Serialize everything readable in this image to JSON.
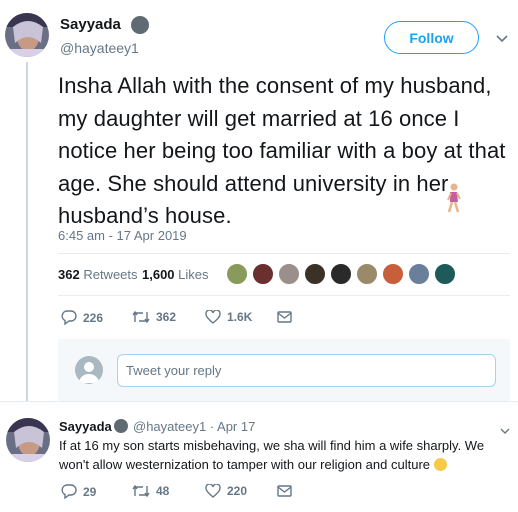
{
  "tweet": {
    "display_name": "Sayyada",
    "handle": "@hayateey1",
    "follow_label": "Follow",
    "text": "Insha Allah with the consent of my husband, my daughter will get married at 16 once I notice her being too familiar with a boy at that age. She should attend university in her husband’s house.",
    "timestamp": "6:45 am - 17 Apr 2019",
    "retweets_count": "362",
    "retweets_label": "Retweets",
    "likes_count": "1,600",
    "likes_label": "Likes",
    "actions": {
      "reply_count": "226",
      "retweet_count": "362",
      "like_count": "1.6K"
    }
  },
  "reply_composer": {
    "placeholder": "Tweet your reply"
  },
  "reply": {
    "display_name": "Sayyada",
    "handle_time": "@hayateey1 · Apr 17",
    "text": "If at 16 my son starts misbehaving, we sha will find him a wife sharply. We won't allow westernization to tamper with our religion and culture",
    "actions": {
      "reply_count": "29",
      "retweet_count": "48",
      "like_count": "220"
    }
  },
  "colors": {
    "accent": "#1da1f2",
    "secondary_text": "#657786",
    "divider": "#e6ecf0"
  }
}
